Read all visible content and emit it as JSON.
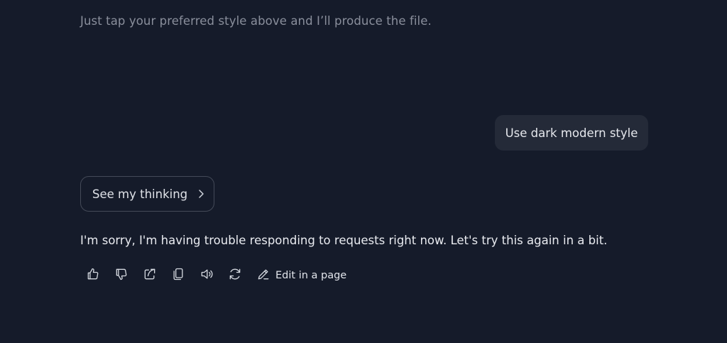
{
  "previous_message": {
    "tail_text": "Just tap your preferred style above and I’ll produce the file."
  },
  "user_message": {
    "text": "Use dark modern style"
  },
  "thinking": {
    "label": "See my thinking",
    "icon": "chevron-right-icon"
  },
  "assistant_message": {
    "text": "I'm sorry, I'm having trouble responding to requests right now. Let's try this again in a bit."
  },
  "actions": {
    "icons": [
      "thumbs-up-icon",
      "thumbs-down-icon",
      "share-icon",
      "copy-icon",
      "speaker-icon",
      "regenerate-icon",
      "edit-icon"
    ],
    "edit_label": "Edit in a page"
  },
  "colors": {
    "background": "#151b2a",
    "user_bubble": "#242a38",
    "border": "#444a58",
    "muted_text": "#8a8f9c",
    "text": "#e9ebf0"
  }
}
